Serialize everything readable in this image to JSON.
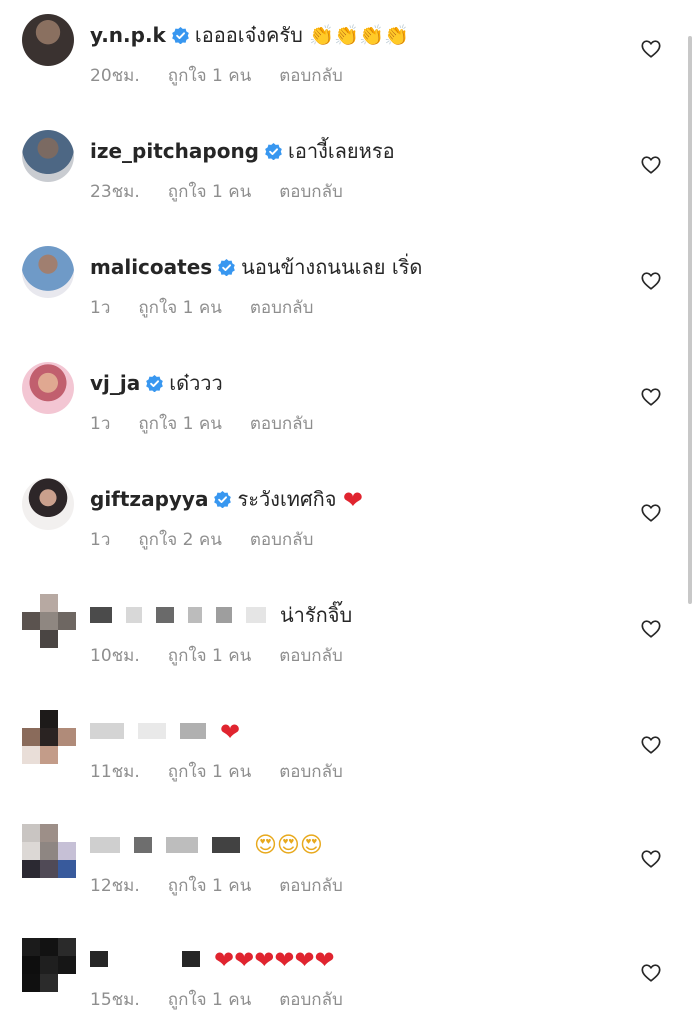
{
  "comments": [
    {
      "username": "y.n.p.k",
      "verified": true,
      "text": "เอออเจ๋งครับ",
      "emoji": "👏👏👏👏",
      "time": "20ชม.",
      "likes": "ถูกใจ 1 คน",
      "reply": "ตอบกลับ"
    },
    {
      "username": "ize_pitchapong",
      "verified": true,
      "text": "เอางี้เลยหรอ",
      "emoji": "",
      "time": "23ชม.",
      "likes": "ถูกใจ 1 คน",
      "reply": "ตอบกลับ"
    },
    {
      "username": "malicoates",
      "verified": true,
      "text": "นอนข้างถนนเลย เริ่ด",
      "emoji": "",
      "time": "1ว",
      "likes": "ถูกใจ 1 คน",
      "reply": "ตอบกลับ"
    },
    {
      "username": "vj_ja",
      "verified": true,
      "text": "เด๋ววว",
      "emoji": "",
      "time": "1ว",
      "likes": "ถูกใจ 1 คน",
      "reply": "ตอบกลับ"
    },
    {
      "username": "giftzapyya",
      "verified": true,
      "text": "ระวังเทศกิจ",
      "emoji": "❤",
      "time": "1ว",
      "likes": "ถูกใจ 2 คน",
      "reply": "ตอบกลับ"
    },
    {
      "username": "",
      "verified": false,
      "text": "น่ารักจิ๊บ",
      "emoji": "",
      "time": "10ชม.",
      "likes": "ถูกใจ 1 คน",
      "reply": "ตอบกลับ"
    },
    {
      "username": "",
      "verified": false,
      "text": "",
      "emoji": "❤",
      "time": "11ชม.",
      "likes": "ถูกใจ 1 คน",
      "reply": "ตอบกลับ"
    },
    {
      "username": "",
      "verified": false,
      "text": "",
      "emoji": "😍😍😍",
      "time": "12ชม.",
      "likes": "ถูกใจ 1 คน",
      "reply": "ตอบกลับ"
    },
    {
      "username": "",
      "verified": false,
      "text": "",
      "emoji": "❤❤❤❤❤❤",
      "time": "15ชม.",
      "likes": "ถูกใจ 1 คน",
      "reply": "ตอบกลับ"
    }
  ],
  "colors": {
    "verified_badge": "#3897f0",
    "heart_emoji": "#e0242f",
    "meta_text": "#8e8e8e",
    "username_text": "#262626"
  },
  "icons": {
    "like": "heart-outline-icon",
    "verified": "verified-badge-icon"
  }
}
